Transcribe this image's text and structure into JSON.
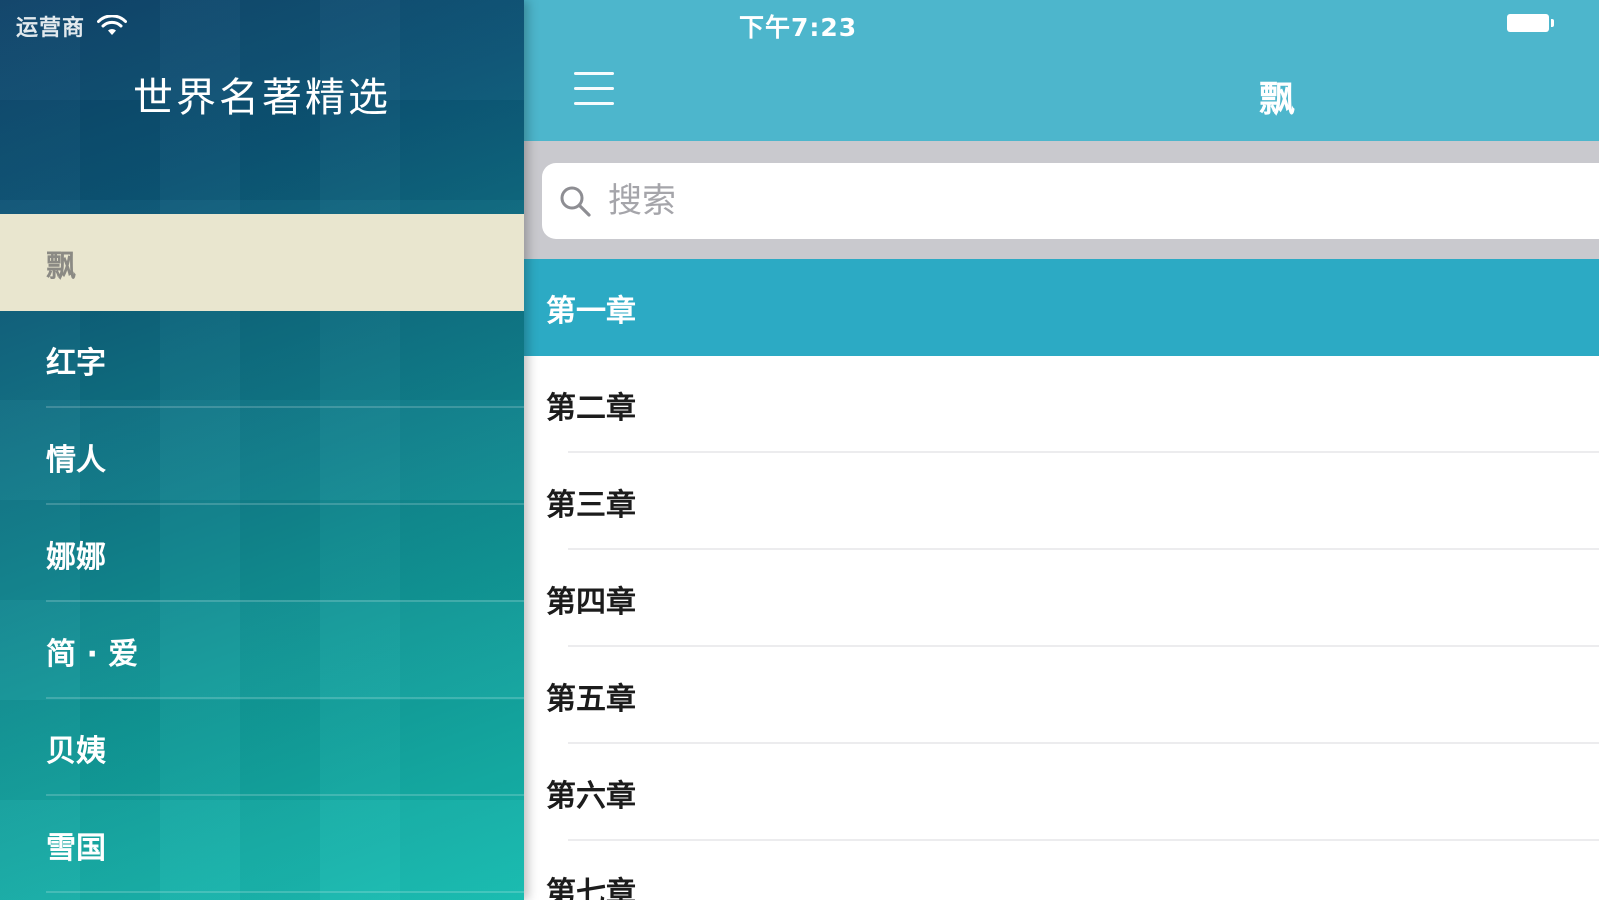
{
  "status": {
    "carrier": "运营商",
    "time": "下午7:23"
  },
  "sidebar": {
    "title": "世界名著精选",
    "books": [
      {
        "label": "飘",
        "selected": true
      },
      {
        "label": "红字",
        "selected": false
      },
      {
        "label": "情人",
        "selected": false
      },
      {
        "label": "娜娜",
        "selected": false
      },
      {
        "label": "简 · 爱",
        "selected": false
      },
      {
        "label": "贝姨",
        "selected": false
      },
      {
        "label": "雪国",
        "selected": false
      }
    ]
  },
  "navbar": {
    "title": "飘",
    "menu_icon": "hamburger-menu-icon"
  },
  "search": {
    "placeholder": "搜索",
    "value": ""
  },
  "chapters": [
    {
      "label": "第一章",
      "selected": true
    },
    {
      "label": "第二章",
      "selected": false
    },
    {
      "label": "第三章",
      "selected": false
    },
    {
      "label": "第四章",
      "selected": false
    },
    {
      "label": "第五章",
      "selected": false
    },
    {
      "label": "第六章",
      "selected": false
    },
    {
      "label": "第七章",
      "selected": false
    }
  ],
  "colors": {
    "navbar": "#4db6cc",
    "selected_chapter": "#2caac4",
    "selected_book": "#e9e6cf",
    "search_bar_bg": "#c9c9ce"
  }
}
